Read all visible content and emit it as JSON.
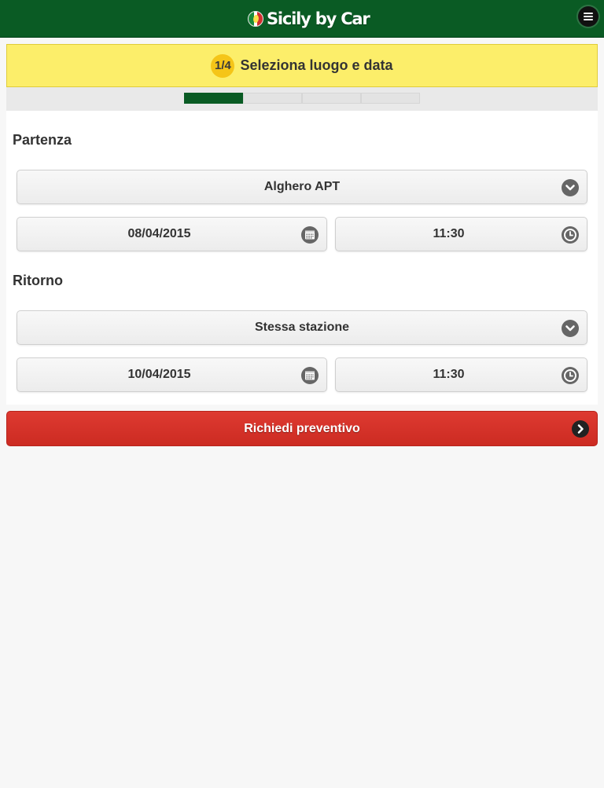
{
  "header": {
    "logo_text": "Sicily by Car",
    "menu_icon": "hamburger-menu-icon",
    "colors": {
      "background": "#0a5b24",
      "logo_text": "#ffffff"
    }
  },
  "step": {
    "badge": "1/4",
    "title": "Seleziona luogo e data",
    "current": 1,
    "total": 4,
    "colors": {
      "banner": "#fcee6a",
      "badge": "#f5c518",
      "progress_active": "#0a5b24"
    }
  },
  "departure": {
    "label": "Partenza",
    "location": "Alghero APT",
    "date": "08/04/2015",
    "time": "11:30"
  },
  "return": {
    "label": "Ritorno",
    "location": "Stessa stazione",
    "date": "10/04/2015",
    "time": "11:30"
  },
  "icons": {
    "location_select": "chevron-down-icon",
    "date": "calendar-icon",
    "time": "clock-icon",
    "submit": "chevron-right-icon"
  },
  "submit": {
    "label": "Richiedi preventivo",
    "color": "#d6322a"
  }
}
